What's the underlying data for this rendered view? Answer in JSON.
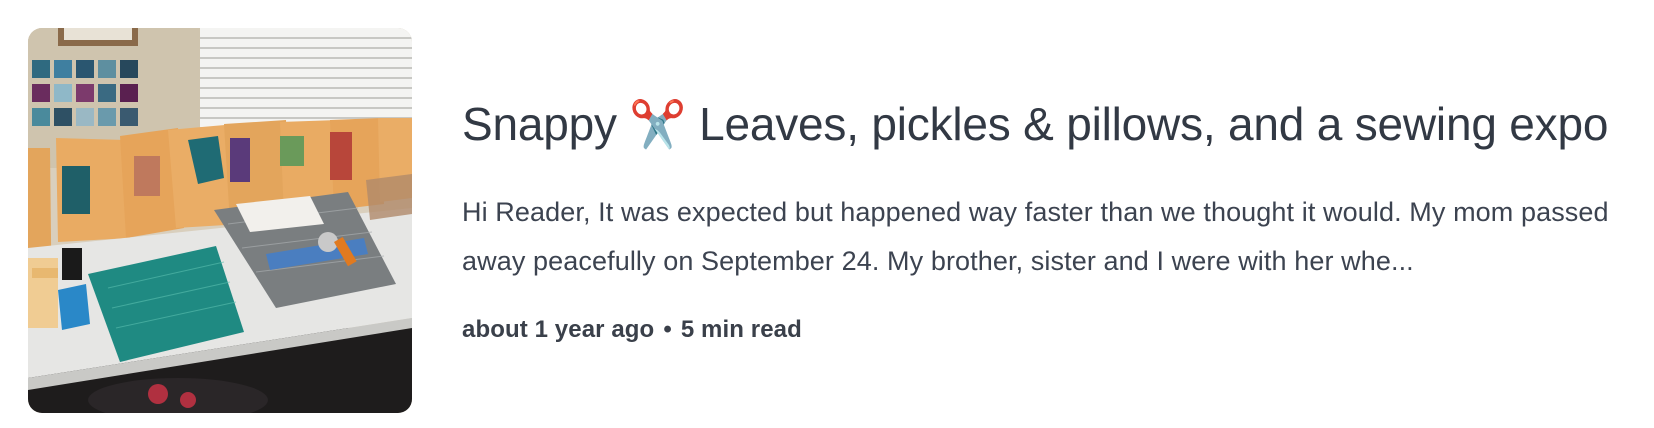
{
  "post": {
    "title_prefix": "Snappy",
    "title_emoji": "✂️",
    "title_rest": "Leaves, pickles & pillows, and a sewing expo",
    "excerpt": "Hi Reader, It was expected but happened way faster than we thought it would. My mom passed away peacefully on September 24. My brother, sister and I were with her whe...",
    "published": "about 1 year ago",
    "separator": "•",
    "read_time": "5 min read",
    "thumbnail_icon": "sewing-workspace-photo"
  },
  "colors": {
    "title": "#323944",
    "body": "#3c4350"
  }
}
